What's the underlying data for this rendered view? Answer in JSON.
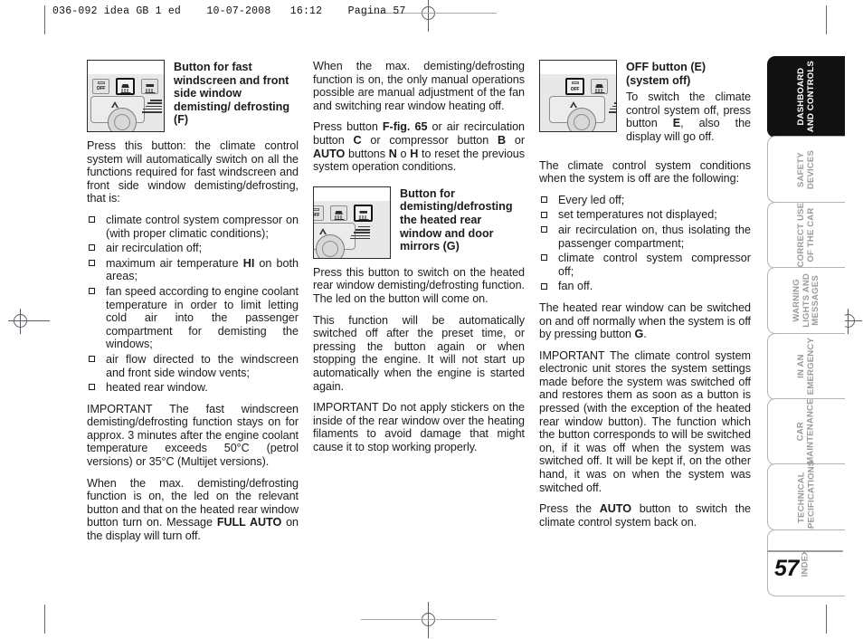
{
  "header": {
    "running_head": "036-092 idea GB 1 ed    10-07-2008   16:12    Pagina 57"
  },
  "page": {
    "number": "57"
  },
  "column1": {
    "figure": {
      "name": "climate-control-panel-fast-demist",
      "highlighted_button": "front-windscreen-defrost",
      "buttons": [
        "OFF",
        "front-defrost",
        "rear-defrost"
      ]
    },
    "heading": "Button for fast windscreen and front side window demisting/ defrosting (F)",
    "intro": "Press this button: the climate control system will automatically switch on all the functions required for fast windscreen and front side window demisting/defrosting, that is:",
    "bullets": [
      {
        "text": "climate control system compressor on (with proper climatic conditions);"
      },
      {
        "text": "air recirculation off;"
      },
      {
        "pre": "maximum air temperature ",
        "bold": "HI",
        "post": " on both areas;"
      },
      {
        "text": "fan speed according to engine coolant temperature in order to limit letting cold air into the passenger compartment for demisting the windows;"
      },
      {
        "text": "air flow directed to the windscreen and front side window vents;"
      },
      {
        "text": "heated rear window."
      }
    ],
    "important_label": "IMPORTANT",
    "important_text": " The fast windscreen demisting/defrosting function stays on for approx. 3 minutes after the engine coolant temperature exceeds 50°C (petrol versions) or 35°C (Multijet versions).",
    "para_fullauto_pre": "When the max. demisting/defrosting function is on, the led on the relevant button and that on the heated rear window button turn on. Message ",
    "para_fullauto_bold": "FULL AUTO",
    "para_fullauto_post": " on the display will turn off."
  },
  "column2": {
    "para1": "When the max. demisting/defrosting function is on, the only manual operations possible are manual adjustment of the fan and switching rear window heating off.",
    "para2_pre": "Press button ",
    "para2_b1": "F-fig. 65",
    "para2_m1": " or air recirculation button ",
    "para2_b2": "C",
    "para2_m2": " or compressor button ",
    "para2_b3": "B",
    "para2_m3": " or ",
    "para2_b4": "AUTO",
    "para2_m4": " buttons ",
    "para2_b5": "N",
    "para2_m5": " o ",
    "para2_b6": "H",
    "para2_post": " to reset the previous system operation conditions.",
    "figure": {
      "name": "climate-control-panel-heated-rear-window",
      "highlighted_button": "rear-defrost",
      "buttons": [
        "front-defrost",
        "rear-defrost"
      ]
    },
    "heading": "Button for demisting/defrosting the heated rear window and door mirrors (G)",
    "para3": "Press this button to switch on the heated rear window demisting/defrosting function. The led on the button will come on.",
    "para4": "This function will be automatically switched off after the preset time, or pressing the button again or when stopping the engine. It will not start up automatically when the engine is started again.",
    "important_label": "IMPORTANT",
    "important_text": " Do not apply stickers on the inside of the rear window over the heating filaments to avoid damage that might cause it to stop working properly."
  },
  "column3": {
    "figure": {
      "name": "climate-control-panel-off-button",
      "highlighted_button": "off",
      "buttons": [
        "OFF",
        "front-defrost"
      ]
    },
    "heading": "OFF button (E) (system off)",
    "intro_pre": "To switch the climate control system off, press button ",
    "intro_bold": "E",
    "intro_post": ", also the display will go off.",
    "conditions_lead": "The climate control system conditions when the system is off are the following:",
    "bullets": [
      {
        "text": "Every led off;"
      },
      {
        "text": "set temperatures not displayed;"
      },
      {
        "text": "air recirculation on, thus isolating the passenger compartment;"
      },
      {
        "text": "climate control system compressor off;"
      },
      {
        "text": "fan off."
      }
    ],
    "para_rear_pre": "The heated rear window can be switched on and off normally when the system is off by pressing button ",
    "para_rear_bold": "G",
    "para_rear_post": ".",
    "important_label": "IMPORTANT",
    "important_text": " The climate control system electronic unit stores the system settings made before the system was switched off and restores them as soon as a button is pressed (with the exception of the heated rear window button). The function which the button corresponds to will be switched on, if it was off when the system was switched off. It will be kept if, on the other hand, it was on when the system was switched off.",
    "para_auto_pre": "Press the ",
    "para_auto_bold": "AUTO",
    "para_auto_post": " button to switch the climate control system back on."
  },
  "sidebar": {
    "tabs": [
      {
        "label": "DASHBOARD\nAND CONTROLS",
        "active": true
      },
      {
        "label": "SAFETY\nDEVICES",
        "active": false
      },
      {
        "label": "CORRECT USE\nOF THE CAR",
        "active": false
      },
      {
        "label": "WARNING\nLIGHTS AND\nMESSAGES",
        "active": false
      },
      {
        "label": "IN AN\nEMERGENCY",
        "active": false
      },
      {
        "label": "CAR\nMAINTENANCE",
        "active": false
      },
      {
        "label": "TECHNICAL\nSPECIFICATIONS",
        "active": false
      },
      {
        "label": "INDEX",
        "active": false
      }
    ]
  }
}
